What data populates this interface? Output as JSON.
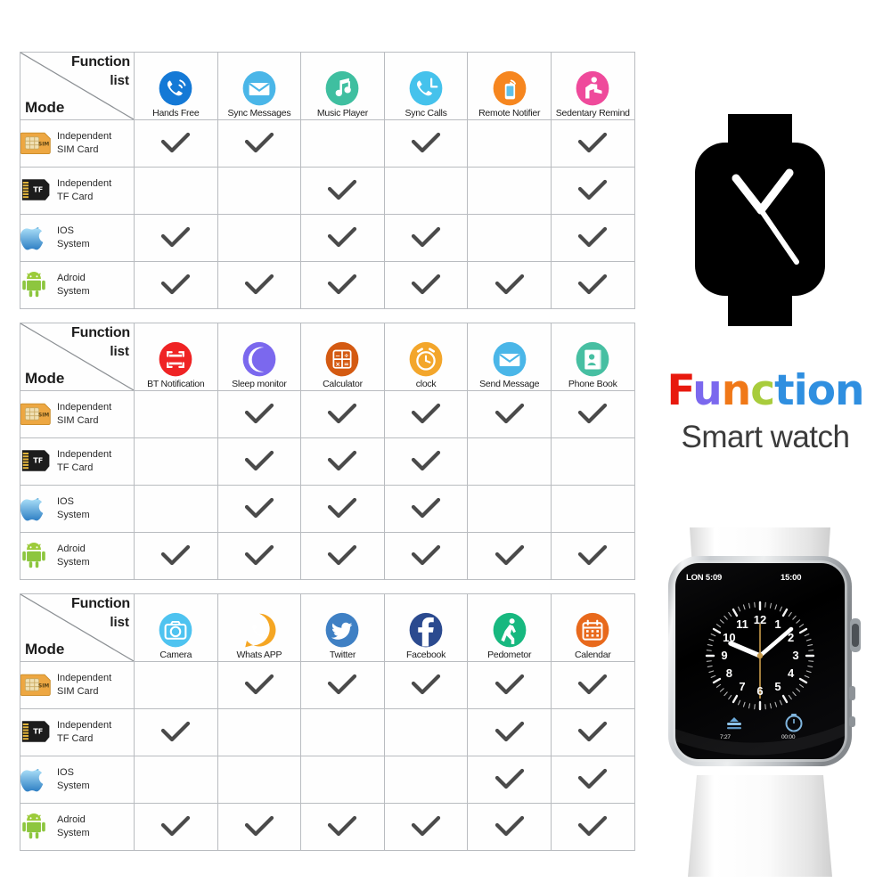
{
  "brand": {
    "title_letters": [
      {
        "ch": "F",
        "color": "#e8190e"
      },
      {
        "ch": "u",
        "color": "#7b68ee"
      },
      {
        "ch": "n",
        "color": "#f07818"
      },
      {
        "ch": "c",
        "color": "#a8cc3c"
      },
      {
        "ch": "t",
        "color": "#2f8fe0"
      },
      {
        "ch": "i",
        "color": "#2f8fe0"
      },
      {
        "ch": "o",
        "color": "#2f8fe0"
      },
      {
        "ch": "n",
        "color": "#2f8fe0"
      }
    ],
    "title_text": "Function",
    "subtitle": "Smart watch"
  },
  "watch_photo": {
    "screen": {
      "city_time": "LON 5:09",
      "digital_time": "15:00",
      "hour_numbers": [
        "12",
        "1",
        "2",
        "3",
        "4",
        "5",
        "6",
        "7",
        "8",
        "9",
        "10",
        "11"
      ],
      "widget_left_label": "7:27",
      "widget_right_label": "00:00",
      "widget_left_icon": "weather-icon",
      "widget_center_icon": "moon-icon",
      "widget_right_icon": "stopwatch-icon"
    }
  },
  "table_common": {
    "corner": {
      "function_word": "Function",
      "list_word": "list",
      "mode_word": "Mode"
    },
    "modes": [
      {
        "icon": "sim-card-icon",
        "line1": "Independent",
        "line2": "SIM  Card"
      },
      {
        "icon": "tf-card-icon",
        "line1": "Independent",
        "line2": "TF  Card"
      },
      {
        "icon": "apple-icon",
        "line1": "IOS",
        "line2": "System"
      },
      {
        "icon": "android-icon",
        "line1": "Adroid",
        "line2": "System"
      }
    ]
  },
  "tables": [
    {
      "id": "table-1",
      "functions": [
        {
          "label": "Hands Free",
          "icon": "phone-call-icon",
          "color": "#1479d6"
        },
        {
          "label": "Sync Messages",
          "icon": "envelope-icon",
          "color": "#4ab6e8"
        },
        {
          "label": "Music Player",
          "icon": "music-note-icon",
          "color": "#3fbfa0"
        },
        {
          "label": "Sync Calls",
          "icon": "phone-sync-icon",
          "color": "#45c2ec"
        },
        {
          "label": "Remote Notifier",
          "icon": "remote-phone-icon",
          "color": "#f6861f"
        },
        {
          "label": "Sedentary Remind",
          "icon": "sedentary-icon",
          "color": "#ef4a9b"
        }
      ],
      "matrix": [
        [
          true,
          true,
          false,
          true,
          false,
          true
        ],
        [
          false,
          false,
          true,
          false,
          false,
          true
        ],
        [
          true,
          false,
          true,
          true,
          false,
          true
        ],
        [
          true,
          true,
          true,
          true,
          true,
          true
        ]
      ]
    },
    {
      "id": "table-2",
      "functions": [
        {
          "label": "BT Notification",
          "icon": "bt-scan-icon",
          "color": "#ef2324"
        },
        {
          "label": "Sleep monitor",
          "icon": "moon-icon",
          "color": "#7b68ee"
        },
        {
          "label": "Calculator",
          "icon": "calculator-icon",
          "color": "#d45a12"
        },
        {
          "label": "clock",
          "icon": "alarm-clock-icon",
          "color": "#f3a62b"
        },
        {
          "label": "Send Message",
          "icon": "envelope-icon",
          "color": "#4ab6e8"
        },
        {
          "label": "Phone Book",
          "icon": "phone-book-icon",
          "color": "#47bfa2"
        }
      ],
      "matrix": [
        [
          false,
          true,
          true,
          true,
          true,
          true
        ],
        [
          false,
          true,
          true,
          true,
          false,
          false
        ],
        [
          false,
          true,
          true,
          true,
          false,
          false
        ],
        [
          true,
          true,
          true,
          true,
          true,
          true
        ]
      ]
    },
    {
      "id": "table-3",
      "functions": [
        {
          "label": "Camera",
          "icon": "camera-icon",
          "color": "#4ec3f0"
        },
        {
          "label": "Whats APP",
          "icon": "whatsapp-icon",
          "color": "#f5a623"
        },
        {
          "label": "Twitter",
          "icon": "twitter-icon",
          "color": "#3f80c4"
        },
        {
          "label": "Facebook",
          "icon": "facebook-icon",
          "color": "#2b4a8f"
        },
        {
          "label": "Pedometor",
          "icon": "pedometer-icon",
          "color": "#17b87f"
        },
        {
          "label": "Calendar",
          "icon": "calendar-icon",
          "color": "#e8691c"
        }
      ],
      "matrix": [
        [
          false,
          true,
          true,
          true,
          true,
          true
        ],
        [
          true,
          false,
          false,
          false,
          true,
          true
        ],
        [
          false,
          false,
          false,
          false,
          true,
          true
        ],
        [
          true,
          true,
          true,
          true,
          true,
          true
        ]
      ]
    }
  ]
}
